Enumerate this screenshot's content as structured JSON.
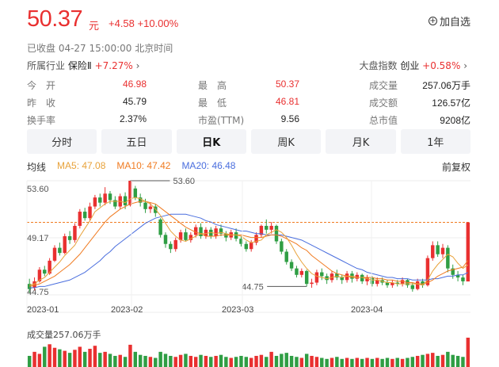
{
  "quote": {
    "price": "50.37",
    "unit": "元",
    "change": "+4.58 +10.00%",
    "status": "已收盘  04-27 15:00:00  北京时间",
    "add_watchlist": "加自选",
    "industry_label": "所属行业",
    "industry_name": "保险Ⅱ",
    "industry_pct": "+7.27%",
    "index_label": "大盘指数",
    "index_name": "创业",
    "index_pct": "+0.58%"
  },
  "stats": [
    {
      "label": "今　开",
      "value": "46.98",
      "color": "#e93030"
    },
    {
      "label": "最　高",
      "value": "50.37",
      "color": "#e93030"
    },
    {
      "label": "成交量",
      "value": "257.06万手",
      "color": "#222222"
    },
    {
      "label": "昨　收",
      "value": "45.79",
      "color": "#222222"
    },
    {
      "label": "最　低",
      "value": "46.81",
      "color": "#e93030"
    },
    {
      "label": "成交额",
      "value": "126.57亿",
      "color": "#222222"
    },
    {
      "label": "换手率",
      "value": "2.37%",
      "color": "#222222"
    },
    {
      "label": "市盈(TTM)",
      "value": "9.56",
      "color": "#222222"
    },
    {
      "label": "总市值",
      "value": "9208亿",
      "color": "#222222"
    }
  ],
  "tabs": [
    "分时",
    "五日",
    "日K",
    "周K",
    "月K",
    "1年"
  ],
  "active_tab": "日K",
  "ma": {
    "label": "均线",
    "ma5": "MA5: 47.08",
    "ma10": "MA10: 47.42",
    "ma20": "MA20: 46.48",
    "ma5_color": "#e8a23a",
    "ma10_color": "#f07b21",
    "ma20_color": "#4a6ede"
  },
  "adjust_label": "前复权",
  "volume_label": "成交量257.06万手",
  "colors": {
    "up": "#e93030",
    "down": "#2f9e44",
    "accent": "#e93030"
  },
  "chart_data": {
    "type": "candlestick",
    "y_ticks": [
      "53.60",
      "49.17",
      "44.75"
    ],
    "x_ticks": [
      "2023-01",
      "2023-02",
      "2023-03",
      "2023-04"
    ],
    "ylim": [
      44.75,
      53.6
    ],
    "annotations": {
      "high": "53.60",
      "low": "44.75"
    },
    "reference_line": 50.37,
    "candles": [
      [
        45.6,
        45.2,
        46.0,
        44.9
      ],
      [
        45.3,
        45.8,
        46.1,
        45.1
      ],
      [
        45.8,
        46.7,
        46.9,
        45.7
      ],
      [
        46.7,
        46.4,
        47.0,
        46.2
      ],
      [
        46.4,
        47.4,
        47.6,
        46.3
      ],
      [
        47.4,
        48.4,
        48.6,
        47.3
      ],
      [
        48.4,
        48.0,
        48.8,
        47.8
      ],
      [
        48.0,
        49.3,
        49.5,
        47.9
      ],
      [
        49.3,
        49.0,
        49.7,
        48.7
      ],
      [
        49.0,
        50.1,
        50.3,
        48.8
      ],
      [
        50.1,
        51.2,
        51.4,
        49.9
      ],
      [
        51.2,
        50.7,
        51.5,
        50.5
      ],
      [
        50.7,
        51.6,
        51.9,
        50.5
      ],
      [
        51.6,
        52.3,
        52.5,
        51.4
      ],
      [
        52.3,
        51.9,
        52.6,
        51.6
      ],
      [
        51.9,
        52.6,
        53.1,
        51.7
      ],
      [
        52.6,
        52.1,
        52.8,
        51.8
      ],
      [
        52.1,
        51.6,
        52.4,
        51.4
      ],
      [
        51.6,
        52.4,
        52.6,
        51.4
      ],
      [
        52.4,
        51.7,
        52.7,
        51.4
      ],
      [
        51.7,
        53.6,
        53.6,
        51.6
      ],
      [
        53.0,
        52.3,
        53.2,
        52.1
      ],
      [
        52.3,
        51.9,
        52.6,
        51.6
      ],
      [
        51.9,
        51.4,
        52.2,
        51.1
      ],
      [
        51.4,
        51.6,
        51.9,
        51.1
      ],
      [
        51.6,
        51.1,
        51.8,
        50.8
      ],
      [
        50.6,
        49.4,
        50.7,
        49.2
      ],
      [
        49.4,
        48.7,
        49.6,
        48.4
      ],
      [
        48.7,
        48.3,
        48.9,
        48.0
      ],
      [
        48.3,
        49.0,
        49.2,
        48.1
      ],
      [
        49.0,
        49.6,
        49.8,
        48.8
      ],
      [
        49.6,
        49.0,
        49.9,
        48.9
      ],
      [
        49.0,
        49.4,
        49.6,
        48.8
      ],
      [
        49.4,
        50.0,
        50.2,
        49.2
      ],
      [
        50.0,
        49.3,
        50.3,
        49.1
      ],
      [
        49.3,
        49.8,
        50.0,
        49.1
      ],
      [
        49.8,
        49.3,
        50.0,
        49.1
      ],
      [
        49.3,
        49.9,
        50.1,
        49.1
      ],
      [
        49.9,
        49.5,
        50.2,
        49.3
      ],
      [
        49.5,
        49.2,
        49.7,
        48.9
      ],
      [
        49.2,
        49.6,
        49.8,
        49.0
      ],
      [
        49.6,
        49.1,
        49.9,
        48.9
      ],
      [
        49.1,
        48.7,
        49.3,
        48.5
      ],
      [
        48.7,
        48.3,
        48.9,
        48.1
      ],
      [
        48.3,
        48.8,
        49.0,
        48.1
      ],
      [
        48.8,
        49.4,
        49.6,
        48.6
      ],
      [
        49.4,
        50.1,
        50.2,
        49.2
      ],
      [
        50.1,
        49.8,
        50.6,
        49.5
      ],
      [
        49.8,
        50.1,
        50.4,
        49.5
      ],
      [
        50.1,
        48.9,
        50.2,
        48.7
      ],
      [
        48.9,
        48.1,
        49.1,
        47.9
      ],
      [
        48.1,
        47.3,
        48.3,
        47.1
      ],
      [
        47.3,
        46.8,
        47.5,
        46.6
      ],
      [
        46.8,
        46.3,
        47.0,
        46.1
      ],
      [
        46.3,
        46.6,
        46.8,
        46.1
      ],
      [
        46.6,
        45.6,
        46.7,
        45.4
      ],
      [
        45.6,
        45.7,
        46.0,
        45.3
      ],
      [
        45.7,
        46.5,
        46.7,
        45.5
      ],
      [
        46.5,
        46.2,
        46.8,
        45.9
      ],
      [
        46.2,
        45.9,
        46.4,
        45.6
      ],
      [
        45.9,
        46.4,
        46.6,
        45.7
      ],
      [
        46.4,
        46.1,
        46.7,
        45.9
      ],
      [
        46.1,
        45.9,
        46.3,
        45.6
      ],
      [
        45.9,
        46.4,
        46.6,
        45.7
      ],
      [
        46.4,
        46.0,
        46.6,
        45.7
      ],
      [
        46.0,
        46.3,
        46.5,
        45.8
      ],
      [
        46.3,
        45.8,
        46.4,
        45.6
      ],
      [
        45.8,
        46.1,
        46.3,
        45.5
      ],
      [
        46.1,
        45.6,
        46.2,
        45.4
      ],
      [
        45.6,
        45.9,
        46.1,
        45.4
      ],
      [
        45.9,
        45.7,
        46.1,
        45.5
      ],
      [
        45.7,
        45.5,
        45.9,
        45.3
      ],
      [
        45.5,
        45.7,
        45.9,
        45.3
      ],
      [
        45.7,
        45.6,
        45.9,
        45.4
      ],
      [
        45.6,
        45.9,
        46.1,
        45.4
      ],
      [
        45.9,
        45.5,
        46.0,
        45.3
      ],
      [
        45.5,
        45.2,
        45.7,
        45.0
      ],
      [
        45.2,
        45.8,
        46.0,
        45.1
      ],
      [
        45.8,
        45.5,
        46.0,
        45.3
      ],
      [
        45.5,
        47.6,
        47.8,
        45.4
      ],
      [
        47.6,
        48.6,
        48.9,
        47.4
      ],
      [
        48.6,
        47.9,
        48.9,
        47.7
      ],
      [
        47.9,
        48.4,
        48.7,
        47.6
      ],
      [
        48.4,
        46.8,
        48.6,
        46.5
      ],
      [
        46.8,
        46.3,
        47.1,
        46.0
      ],
      [
        46.3,
        46.1,
        46.6,
        45.8
      ],
      [
        46.1,
        45.8,
        46.3,
        45.5
      ],
      [
        45.79,
        50.37,
        50.37,
        46.81
      ]
    ],
    "ma5": [
      45.5,
      45.6,
      45.9,
      46.1,
      46.5,
      46.9,
      47.3,
      47.8,
      48.2,
      48.6,
      49.3,
      49.9,
      50.5,
      51.2,
      51.5,
      51.8,
      52.0,
      52.0,
      52.0,
      51.9,
      52.2,
      52.3,
      52.2,
      52.0,
      51.8,
      51.4,
      50.9,
      50.3,
      49.7,
      49.3,
      49.0,
      48.9,
      49.1,
      49.3,
      49.5,
      49.5,
      49.6,
      49.5,
      49.6,
      49.5,
      49.4,
      49.4,
      49.3,
      49.0,
      48.8,
      48.9,
      49.0,
      49.4,
      49.6,
      49.8,
      49.6,
      49.2,
      48.6,
      47.9,
      47.3,
      46.8,
      46.4,
      46.2,
      46.1,
      46.0,
      46.1,
      46.2,
      46.1,
      46.2,
      46.2,
      46.1,
      46.1,
      46.0,
      45.9,
      45.9,
      45.8,
      45.7,
      45.7,
      45.6,
      45.6,
      45.6,
      45.6,
      45.6,
      45.5,
      45.9,
      46.6,
      47.1,
      47.5,
      47.9,
      47.7,
      47.2,
      46.8,
      47.08
    ],
    "ma10": [
      45.4,
      45.5,
      45.6,
      45.8,
      46.0,
      46.2,
      46.5,
      46.8,
      47.1,
      47.5,
      47.9,
      48.4,
      48.9,
      49.4,
      49.9,
      50.4,
      50.8,
      51.1,
      51.4,
      51.6,
      51.8,
      51.9,
      52.0,
      52.0,
      51.9,
      51.8,
      51.5,
      51.2,
      50.9,
      50.6,
      50.3,
      50.0,
      49.8,
      49.6,
      49.5,
      49.3,
      49.3,
      49.3,
      49.4,
      49.4,
      49.4,
      49.4,
      49.4,
      49.3,
      49.2,
      49.2,
      49.2,
      49.3,
      49.4,
      49.4,
      49.3,
      49.1,
      48.9,
      48.7,
      48.4,
      48.2,
      47.8,
      47.5,
      47.2,
      46.9,
      46.6,
      46.4,
      46.3,
      46.2,
      46.1,
      46.1,
      46.1,
      46.1,
      46.1,
      46.0,
      46.0,
      45.9,
      45.9,
      45.8,
      45.8,
      45.7,
      45.7,
      45.6,
      45.6,
      45.7,
      45.9,
      46.2,
      46.4,
      46.6,
      46.7,
      46.8,
      46.9,
      47.42
    ],
    "ma20": [
      45.3,
      45.3,
      45.4,
      45.4,
      45.5,
      45.6,
      45.7,
      45.8,
      45.9,
      46.1,
      46.3,
      46.5,
      46.8,
      47.1,
      47.4,
      47.8,
      48.1,
      48.5,
      48.8,
      49.1,
      49.4,
      49.7,
      50.0,
      50.3,
      50.5,
      50.7,
      50.8,
      50.9,
      51.0,
      51.0,
      51.0,
      51.0,
      50.9,
      50.8,
      50.7,
      50.5,
      50.4,
      50.2,
      50.1,
      50.0,
      49.9,
      49.8,
      49.7,
      49.7,
      49.6,
      49.5,
      49.5,
      49.4,
      49.4,
      49.4,
      49.4,
      49.3,
      49.2,
      49.1,
      49.0,
      48.8,
      48.6,
      48.4,
      48.2,
      48.0,
      47.8,
      47.6,
      47.4,
      47.2,
      47.0,
      46.8,
      46.7,
      46.5,
      46.4,
      46.3,
      46.2,
      46.1,
      46.1,
      46.0,
      46.0,
      46.0,
      45.9,
      45.9,
      45.9,
      45.9,
      46.0,
      46.0,
      46.1,
      46.2,
      46.2,
      46.3,
      46.3,
      46.48
    ],
    "volume": [
      22,
      30,
      26,
      40,
      45,
      38,
      35,
      32,
      28,
      34,
      40,
      30,
      36,
      42,
      28,
      30,
      26,
      22,
      24,
      20,
      44,
      30,
      24,
      22,
      20,
      18,
      30,
      26,
      22,
      20,
      24,
      26,
      22,
      20,
      24,
      22,
      20,
      22,
      24,
      20,
      18,
      20,
      22,
      20,
      18,
      22,
      24,
      20,
      30,
      22,
      26,
      28,
      22,
      20,
      18,
      26,
      22,
      20,
      18,
      16,
      18,
      20,
      16,
      18,
      16,
      18,
      16,
      18,
      16,
      18,
      16,
      18,
      16,
      18,
      16,
      18,
      20,
      22,
      24,
      26,
      28,
      22,
      24,
      30,
      24,
      22,
      20,
      58
    ]
  }
}
